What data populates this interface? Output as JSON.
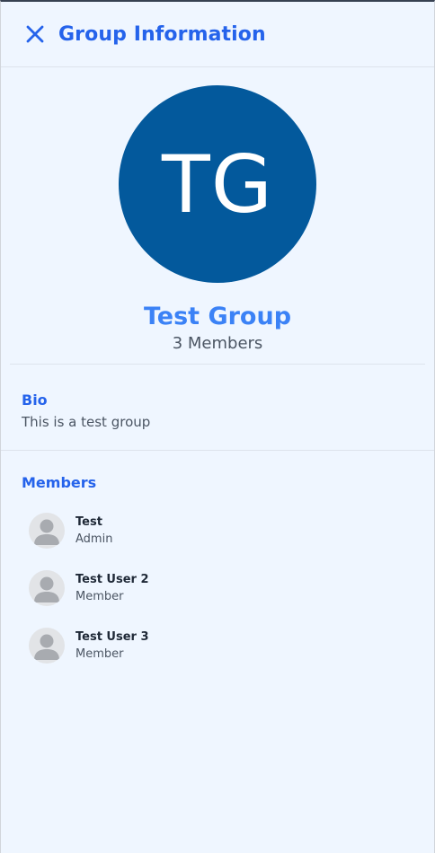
{
  "header": {
    "title": "Group Information",
    "close_icon": "close-icon"
  },
  "group": {
    "initials": "TG",
    "name": "Test Group",
    "member_count": "3 Members",
    "avatar_color": "#03599c"
  },
  "bio": {
    "title": "Bio",
    "text": "This is a test group"
  },
  "members": {
    "title": "Members",
    "items": [
      {
        "name": "Test",
        "role": "Admin",
        "avatar_icon": "user-avatar-icon"
      },
      {
        "name": "Test User 2",
        "role": "Member",
        "avatar_icon": "user-avatar-icon"
      },
      {
        "name": "Test User 3",
        "role": "Member",
        "avatar_icon": "user-avatar-icon"
      }
    ]
  },
  "colors": {
    "accent": "#2563eb",
    "background": "#eff6ff",
    "text_muted": "#4b5563"
  }
}
